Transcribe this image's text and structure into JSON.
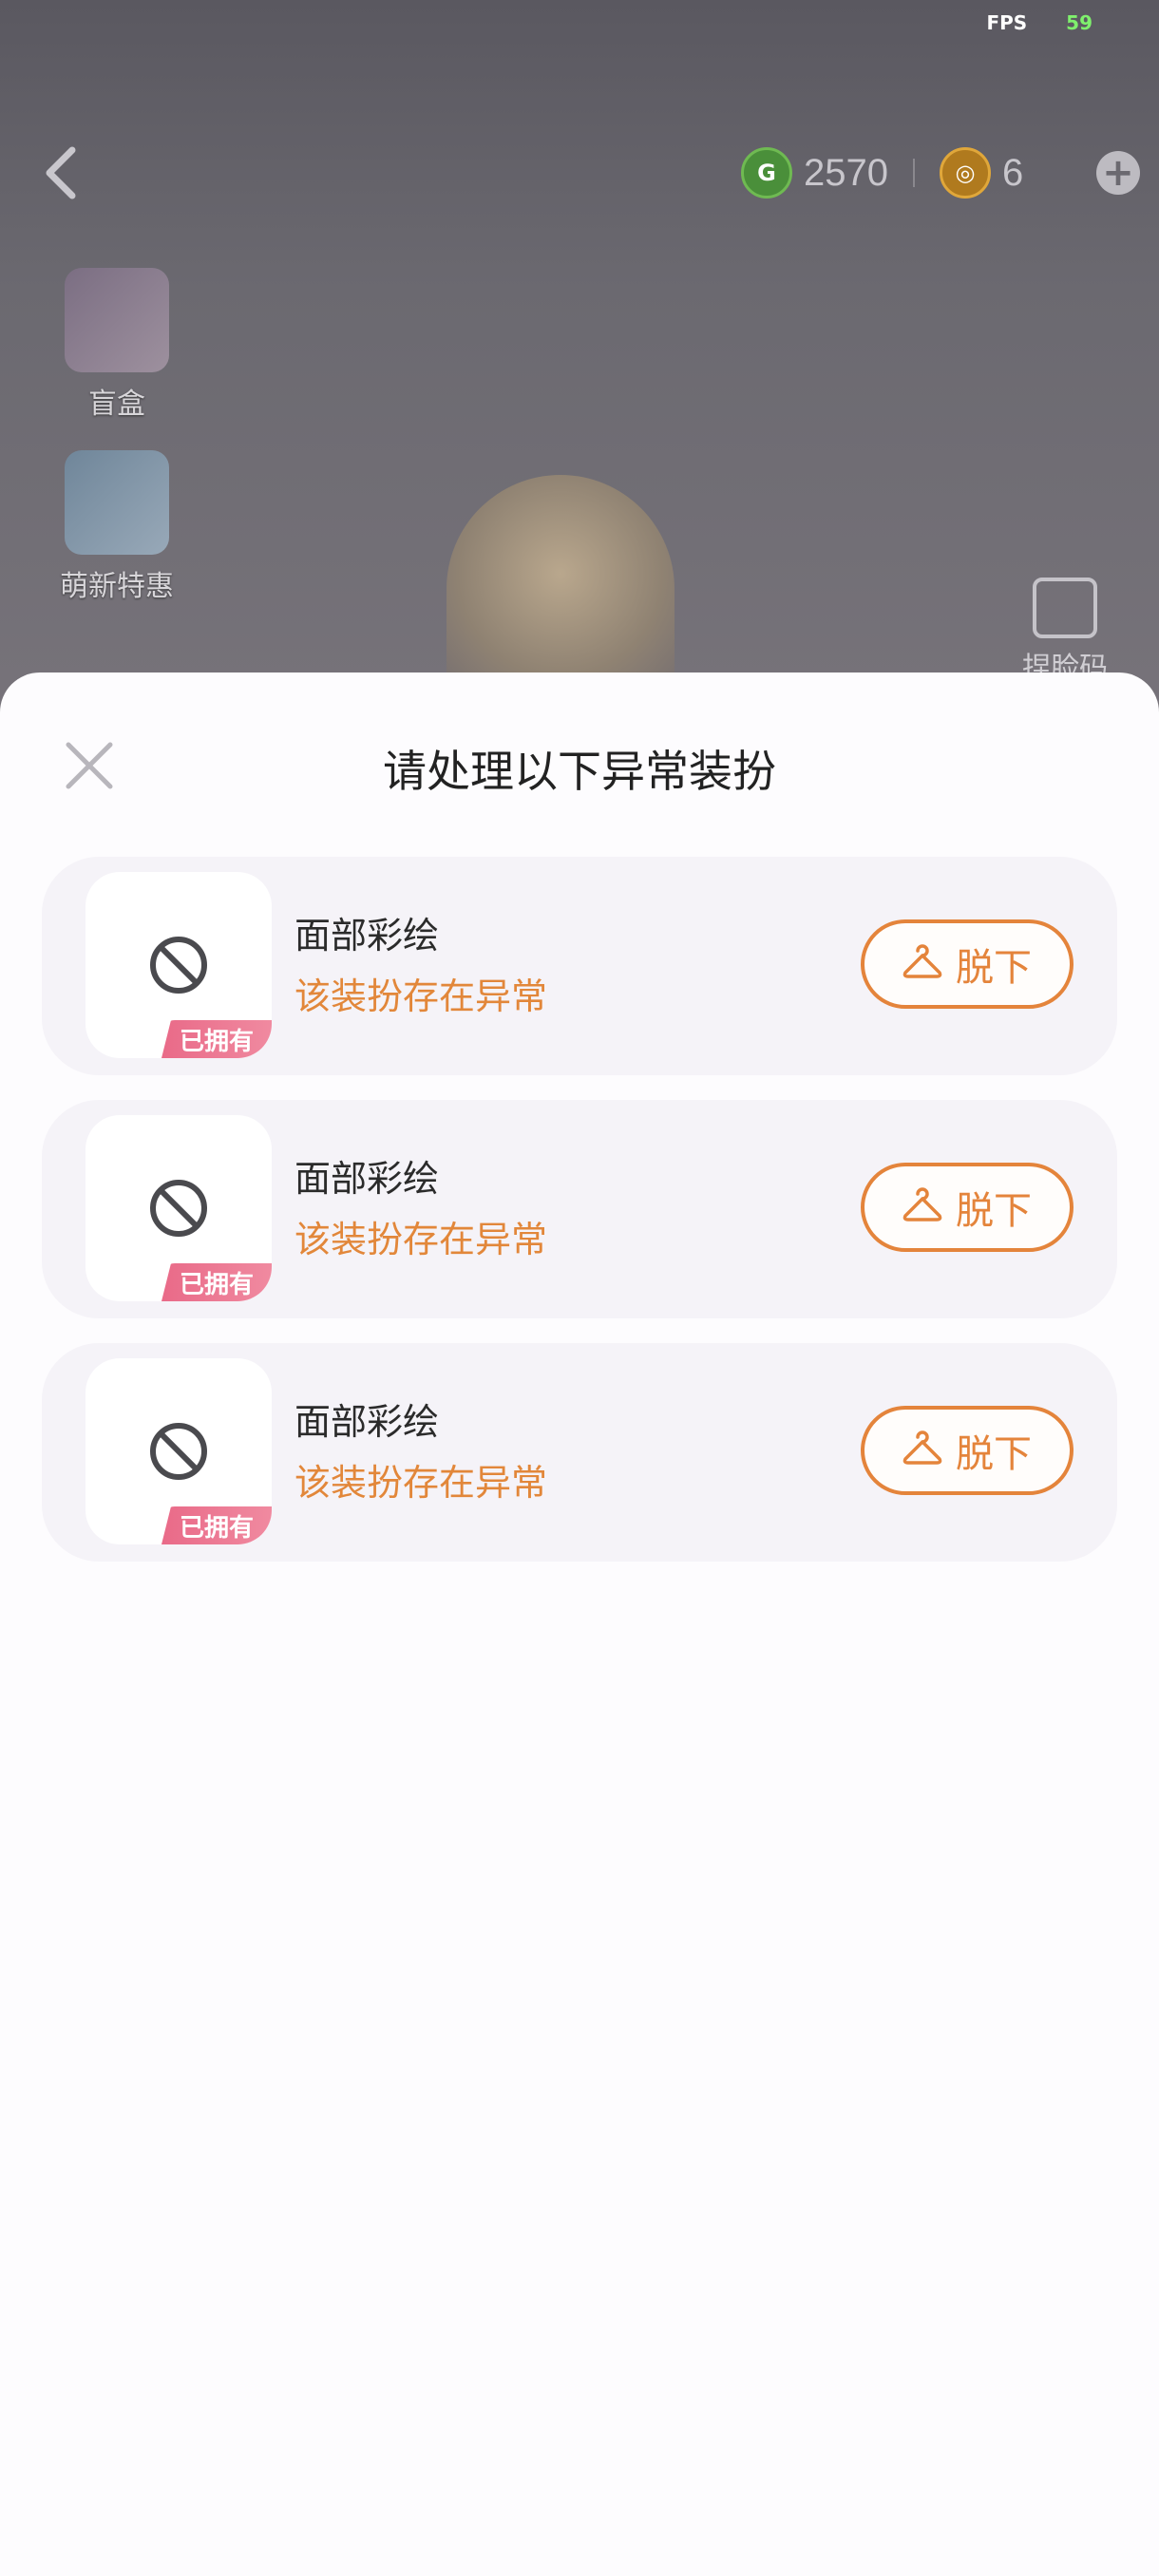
{
  "status": {
    "fps_label": "FPS",
    "fps_value": "59"
  },
  "top_bar": {
    "coins": [
      {
        "icon": "g-coin-icon",
        "value": "2570",
        "color": "#4a8f3a"
      },
      {
        "icon": "gold-coin-icon",
        "value": "6",
        "color": "#b07a1e"
      }
    ]
  },
  "side_menu": {
    "items": [
      {
        "label": "盲盒",
        "icon": "blind-box-icon"
      },
      {
        "label": "萌新特惠",
        "icon": "newbie-offer-icon"
      }
    ]
  },
  "face_code": {
    "label": "捏脸码",
    "icon": "face-code-icon"
  },
  "dialog": {
    "title": "请处理以下异常装扮",
    "items": [
      {
        "name": "面部彩绘",
        "status": "该装扮存在异常",
        "tag": "已拥有",
        "action": "脱下"
      },
      {
        "name": "面部彩绘",
        "status": "该装扮存在异常",
        "tag": "已拥有",
        "action": "脱下"
      },
      {
        "name": "面部彩绘",
        "status": "该装扮存在异常",
        "tag": "已拥有",
        "action": "脱下"
      }
    ]
  },
  "colors": {
    "accent": "#e4843b",
    "tag": "#e96a88",
    "card": "#f5f3f8"
  }
}
